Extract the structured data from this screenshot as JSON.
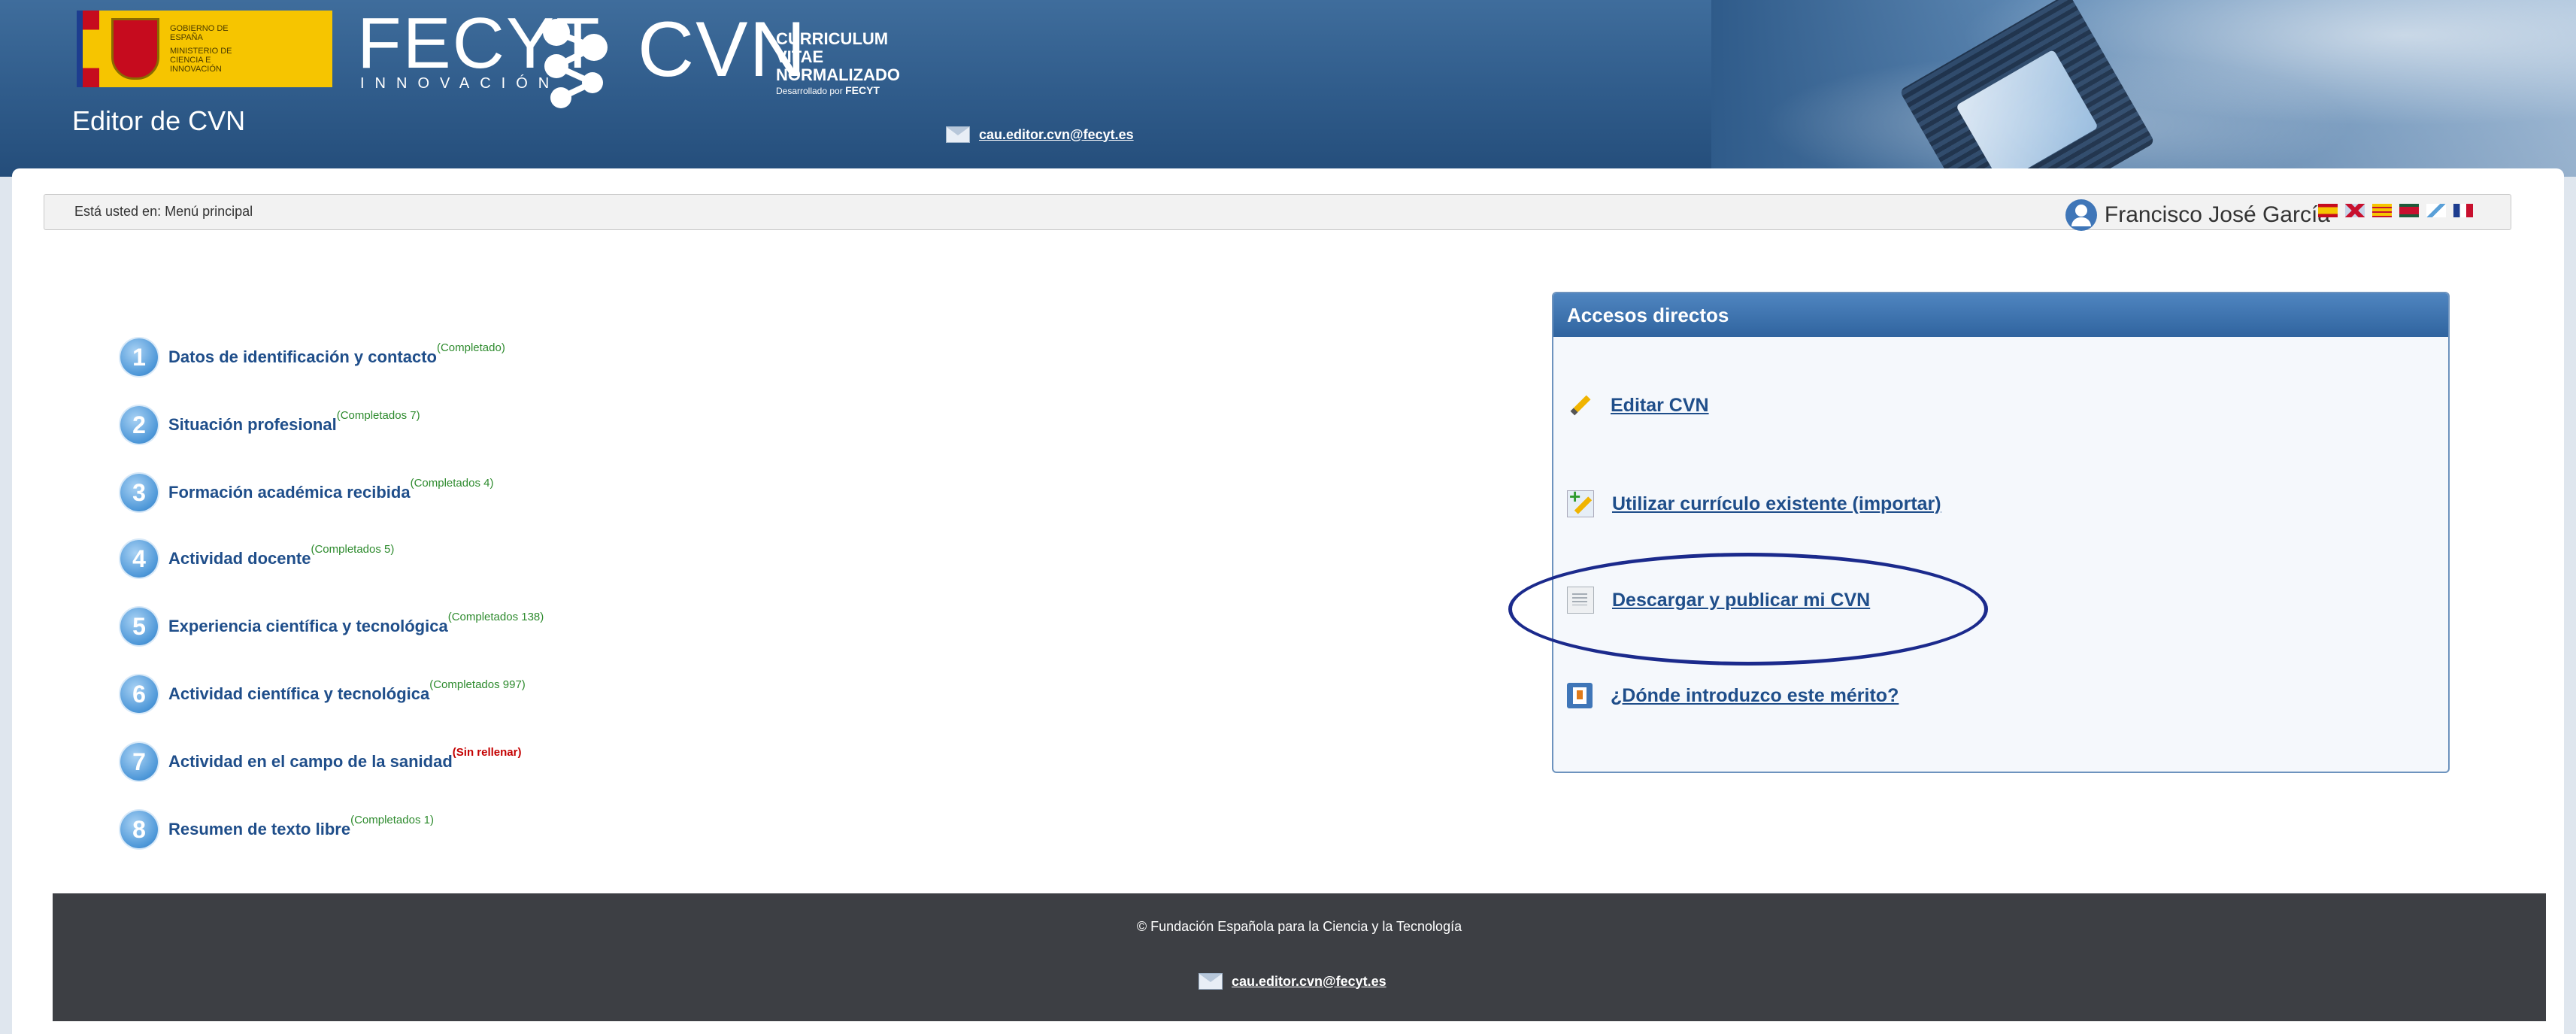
{
  "header": {
    "gov_logo": {
      "line1": "GOBIERNO DE ESPAÑA",
      "line2": "MINISTERIO DE CIENCIA E INNOVACIÓN"
    },
    "fecyt": {
      "name": "FECYT",
      "subtitle": "INNOVACIÓN"
    },
    "cvn": {
      "name": "CVN",
      "line1": "CURRICULUM",
      "line2": "VITAE",
      "line3": "NORMALIZADO",
      "dev_prefix": "Desarrollado por",
      "dev_name": "FECYT"
    },
    "app_title": "Editor de CVN",
    "contact_email": "cau.editor.cvn@fecyt.es"
  },
  "breadcrumb": {
    "text": "Está usted en: Menú principal"
  },
  "user": {
    "name": "Francisco José García"
  },
  "languages": [
    "es",
    "en",
    "ca",
    "eu",
    "gl",
    "fr"
  ],
  "sections": [
    {
      "num": "1",
      "label": "Datos de identificación y contacto",
      "status": "(Completado)",
      "filled": true
    },
    {
      "num": "2",
      "label": "Situación profesional",
      "status": "(Completados 7)",
      "filled": true
    },
    {
      "num": "3",
      "label": "Formación académica recibida",
      "status": "(Completados 4)",
      "filled": true
    },
    {
      "num": "4",
      "label": "Actividad docente",
      "status": "(Completados 5)",
      "filled": true
    },
    {
      "num": "5",
      "label": "Experiencia científica y tecnológica",
      "status": "(Completados 138)",
      "filled": true
    },
    {
      "num": "6",
      "label": "Actividad científica y tecnológica",
      "status": "(Completados 997)",
      "filled": true
    },
    {
      "num": "7",
      "label": "Actividad en el campo de la sanidad",
      "status": "(Sin rellenar)",
      "filled": false
    },
    {
      "num": "8",
      "label": "Resumen de texto libre",
      "status": "(Completados 1)",
      "filled": true
    }
  ],
  "quick_access": {
    "title": "Accesos directos",
    "items": [
      {
        "label": "Editar CVN",
        "icon": "pencil-icon"
      },
      {
        "label": "Utilizar currículo existente (importar)",
        "icon": "import-icon"
      },
      {
        "label": "Descargar y publicar mi CVN",
        "icon": "document-icon"
      },
      {
        "label": "¿Dónde introduzco este mérito?",
        "icon": "help-book-icon"
      }
    ]
  },
  "footer": {
    "copyright": "© Fundación Española para la Ciencia y la Tecnología",
    "email": "cau.editor.cvn@fecyt.es"
  },
  "colors": {
    "header_blue": "#2f5b8a",
    "link_blue": "#1f4e8a",
    "status_green": "#2e8b2e",
    "status_red": "#c40000",
    "footer_bg": "#3d3f44",
    "annotation_ellipse": "#1b2a8c"
  }
}
